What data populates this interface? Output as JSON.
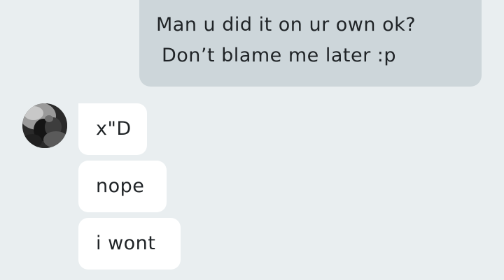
{
  "conversation": {
    "outgoing": {
      "line1": "Man u did it on ur own ok?",
      "line2": "Don’t blame me later :p"
    },
    "incoming": [
      {
        "text": "x\"D"
      },
      {
        "text": "nope"
      },
      {
        "text": "i wont"
      }
    ]
  },
  "colors": {
    "background": "#e9eef0",
    "outgoing_bubble": "#cdd6da",
    "incoming_bubble": "#ffffff",
    "text": "#1f2326"
  }
}
